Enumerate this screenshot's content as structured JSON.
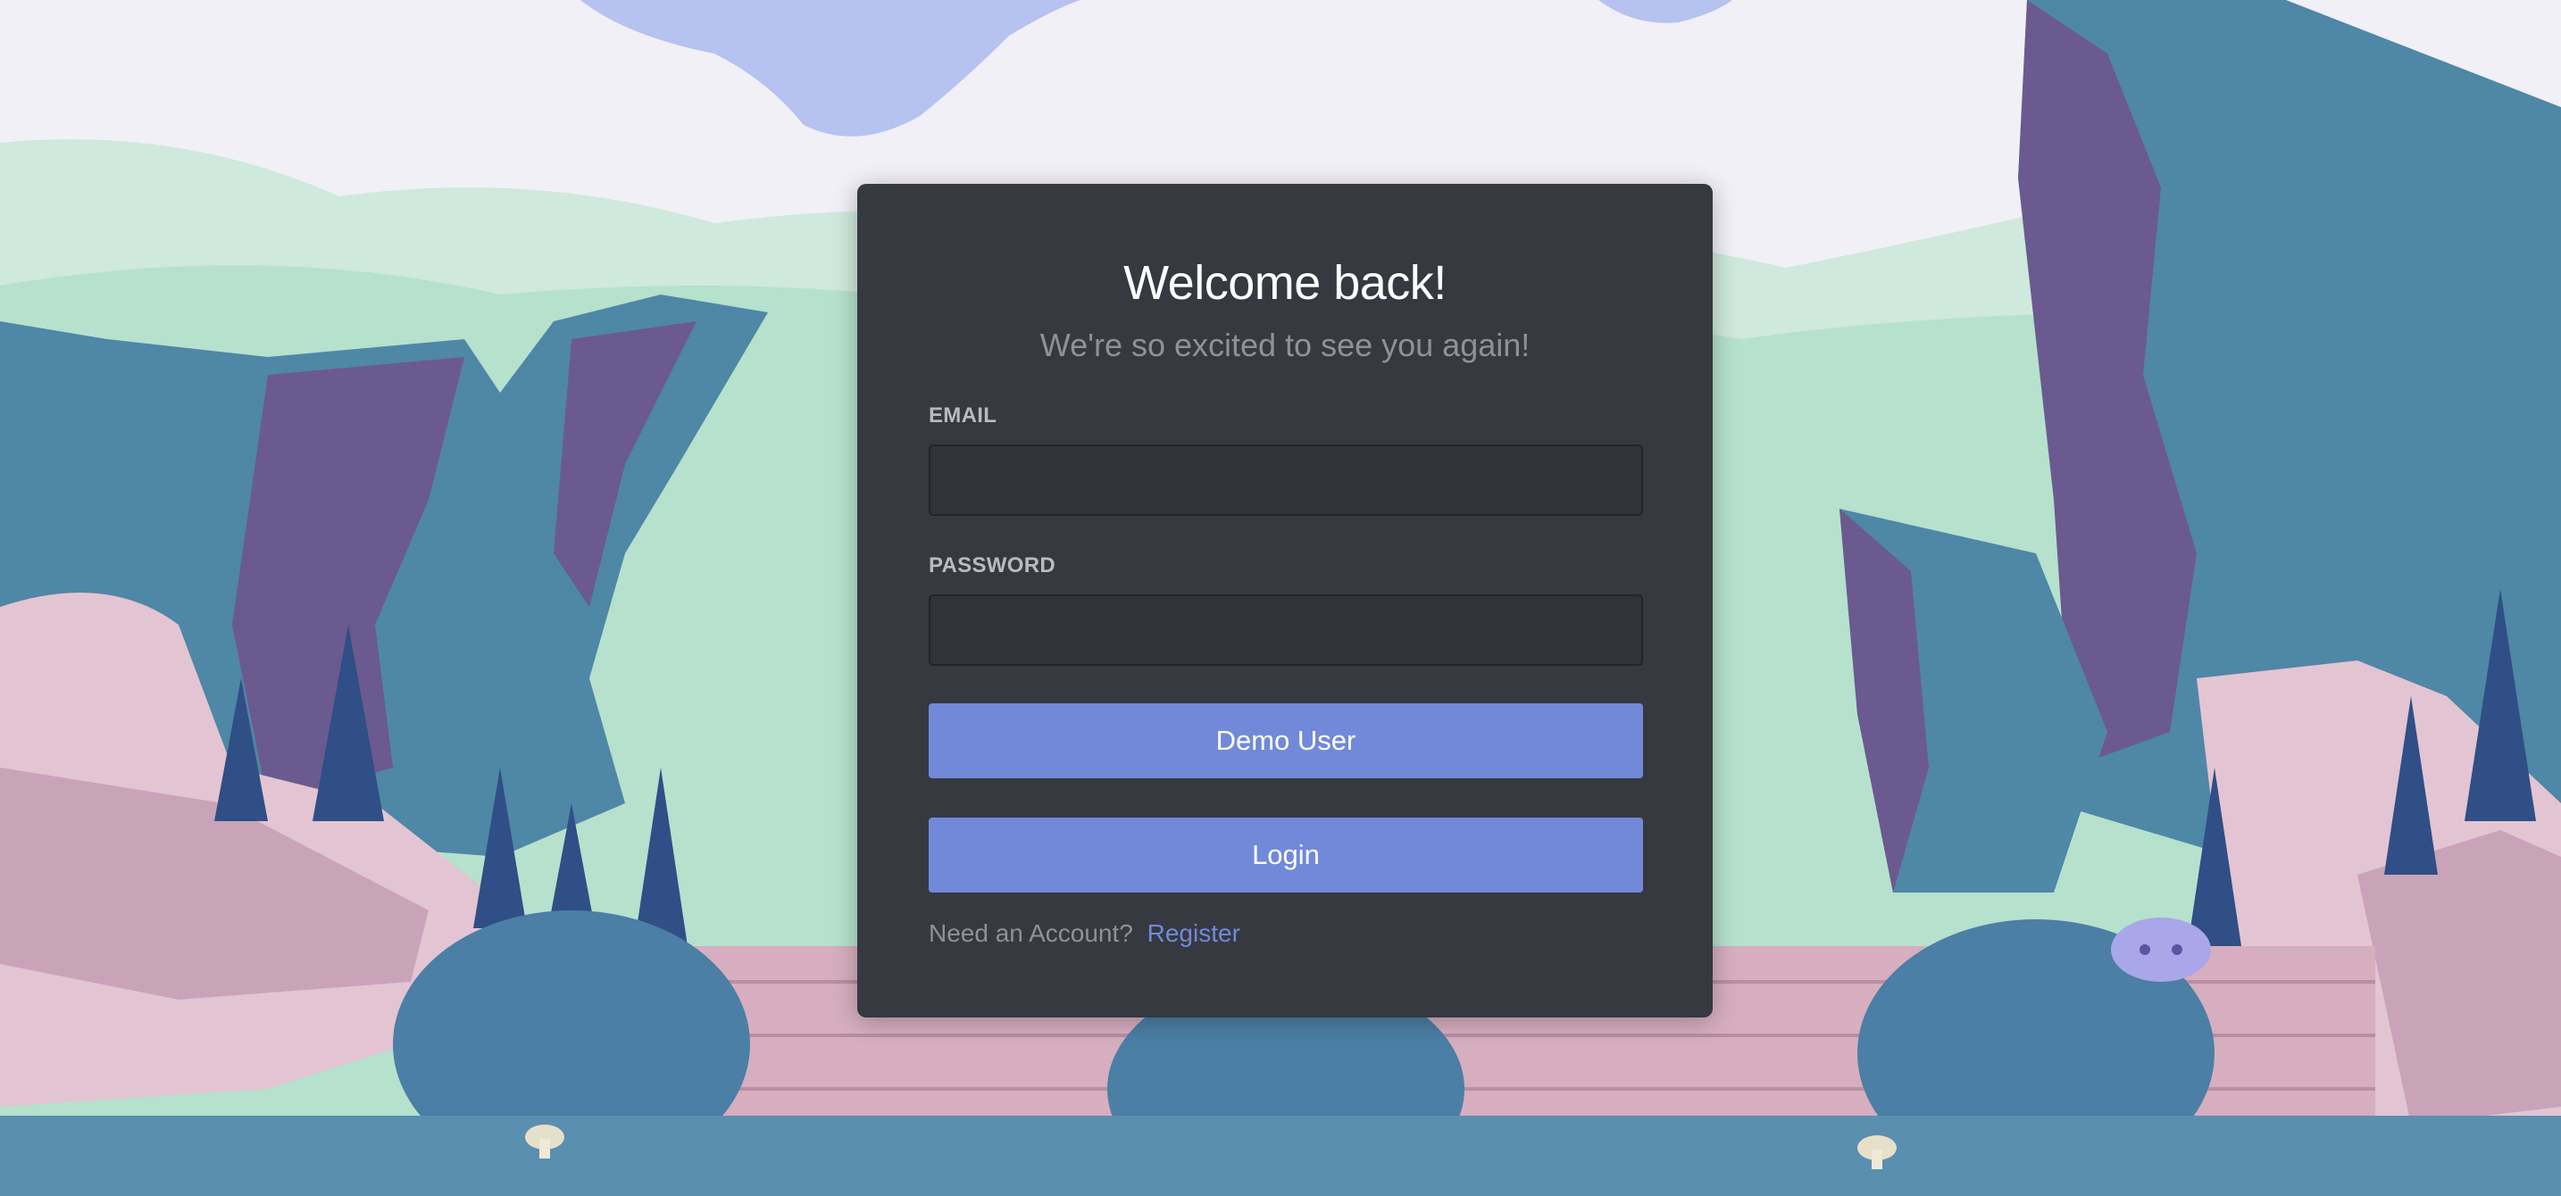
{
  "login": {
    "title": "Welcome back!",
    "subtitle": "We're so excited to see you again!",
    "email_label": "EMAIL",
    "email_value": "",
    "password_label": "PASSWORD",
    "password_value": "",
    "demo_button_label": "Demo User",
    "login_button_label": "Login",
    "footer_prompt": "Need an Account?",
    "register_link_label": "Register"
  },
  "colors": {
    "card_background": "#36393f",
    "accent": "#7289da",
    "input_background": "#303339",
    "muted_text": "#8e9297",
    "label_text": "#b9bbbe"
  },
  "background": {
    "scene": "illustrated-landscape",
    "elements": [
      "sky",
      "clouds",
      "green-hills",
      "cliffs",
      "pine-trees",
      "pink-rocks",
      "bushes",
      "brick-wall",
      "mushrooms",
      "mascot-figure"
    ]
  }
}
